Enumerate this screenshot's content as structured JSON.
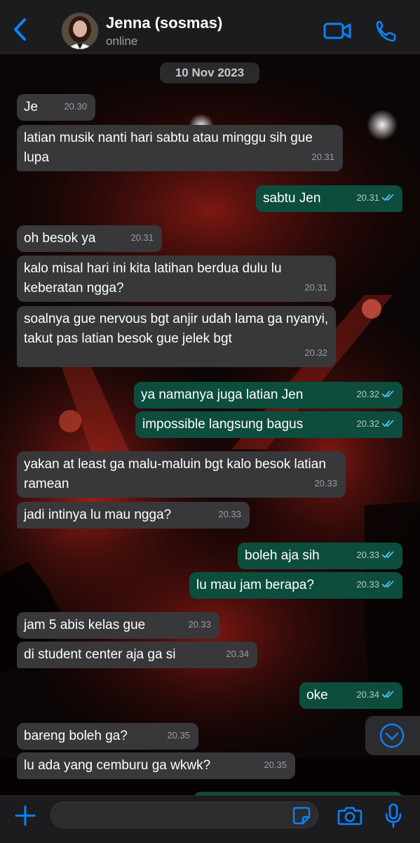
{
  "header": {
    "back_icon": "chevron-left-icon",
    "contact_name": "Jenna (sosmas)",
    "status": "online",
    "video_icon": "video-camera-icon",
    "call_icon": "phone-icon"
  },
  "date_separator": "10 Nov 2023",
  "messages": [
    {
      "dir": "in",
      "text": "Je",
      "time": "20.30"
    },
    {
      "dir": "in",
      "text": "latian musik nanti hari sabtu atau minggu sih gue lupa",
      "time": "20.31"
    },
    {
      "dir": "out",
      "text": "sabtu Jen",
      "time": "20.31",
      "read": true
    },
    {
      "dir": "in",
      "text": "oh besok ya",
      "time": "20.31"
    },
    {
      "dir": "in",
      "text": "kalo misal hari ini kita latihan berdua dulu lu keberatan ngga?",
      "time": "20.31"
    },
    {
      "dir": "in",
      "text": "soalnya gue nervous bgt anjir udah lama ga nyanyi, takut pas latian besok gue jelek bgt",
      "time": "20.32"
    },
    {
      "dir": "out",
      "text": "ya namanya juga latian Jen",
      "time": "20.32",
      "read": true
    },
    {
      "dir": "out",
      "text": "impossible langsung bagus",
      "time": "20.32",
      "read": true
    },
    {
      "dir": "in",
      "text": "yakan at least ga malu-maluin bgt kalo besok latian ramean",
      "time": "20.33"
    },
    {
      "dir": "in",
      "text": "jadi intinya lu mau ngga?",
      "time": "20.33"
    },
    {
      "dir": "out",
      "text": "boleh aja sih",
      "time": "20.33",
      "read": true
    },
    {
      "dir": "out",
      "text": "lu mau jam berapa?",
      "time": "20.33",
      "read": true
    },
    {
      "dir": "in",
      "text": "jam 5 abis kelas gue",
      "time": "20.33"
    },
    {
      "dir": "in",
      "text": "di student center aja ga si",
      "time": "20.34"
    },
    {
      "dir": "out",
      "text": "oke",
      "time": "20.34",
      "read": true
    },
    {
      "dir": "in",
      "text": "bareng boleh ga?",
      "time": "20.35"
    },
    {
      "dir": "in",
      "text": "lu ada yang cemburu ga wkwk?",
      "time": "20.35"
    }
  ],
  "scroll_down_icon": "chevron-down-circle-icon",
  "input_bar": {
    "plus_icon": "plus-icon",
    "message_value": "",
    "sticker_icon": "sticker-icon",
    "camera_icon": "camera-icon",
    "mic_icon": "microphone-icon"
  },
  "colors": {
    "accent": "#0a84ff",
    "incoming_bubble": "#38383b",
    "outgoing_bubble": "#0d4d3e",
    "read_ticks": "#53bdeb"
  }
}
